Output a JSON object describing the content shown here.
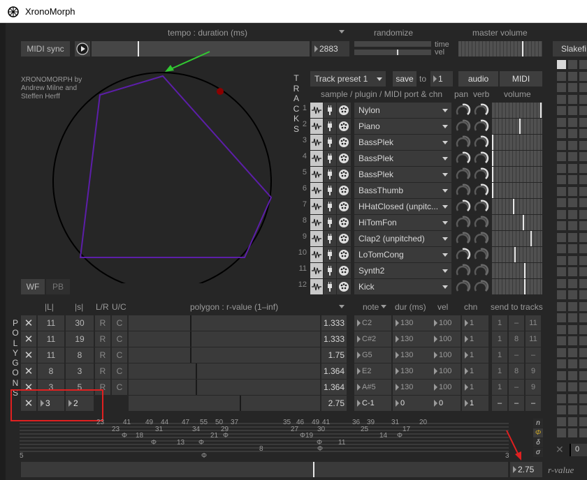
{
  "window": {
    "title": "XronoMorph"
  },
  "transport": {
    "tempo_label": "tempo : duration (ms)",
    "midi_sync": "MIDI sync",
    "tempo_value": "2883",
    "tempo_fraction": 0.21
  },
  "randomize": {
    "label": "randomize",
    "time_label": "time",
    "vel_label": "vel",
    "time_fraction": 0.0,
    "vel_fraction": 0.55
  },
  "master_volume": {
    "label": "master volume",
    "level_fraction": 0.77
  },
  "right_panel": {
    "title": "Slakefi"
  },
  "credits": {
    "line1": "XRONOMORPH by",
    "line2": "Andrew Milne and",
    "line3": "Steffen Herff"
  },
  "tracks": {
    "vertical_label": [
      "T",
      "R",
      "A",
      "C",
      "K",
      "S"
    ],
    "preset": "Track preset 1",
    "save": "save",
    "to": "to",
    "to_value": "1",
    "audio": "audio",
    "midi": "MIDI",
    "col_sample": "sample / plugin / MIDI port & chn",
    "col_pan": "pan",
    "col_verb": "verb",
    "col_volume": "volume",
    "rows": [
      {
        "num": "1",
        "name": "Nylon",
        "vol": 0.99
      },
      {
        "num": "2",
        "name": "Piano",
        "vol": 0.55
      },
      {
        "num": "3",
        "name": "BassPlek",
        "vol": 0.0
      },
      {
        "num": "4",
        "name": "BassPlek",
        "vol": 0.0
      },
      {
        "num": "5",
        "name": "BassPlek",
        "vol": 0.0
      },
      {
        "num": "6",
        "name": "BassThumb",
        "vol": 0.0
      },
      {
        "num": "7",
        "name": "HHatClosed (unpitc...",
        "vol": 0.43
      },
      {
        "num": "8",
        "name": "HiTomFon",
        "vol": 0.63
      },
      {
        "num": "9",
        "name": "Clap2 (unpitched)",
        "vol": 0.78
      },
      {
        "num": "10",
        "name": "LoTomCong",
        "vol": 0.46
      },
      {
        "num": "11",
        "name": "Synth2",
        "vol": 0.65
      },
      {
        "num": "12",
        "name": "Kick",
        "vol": 0.65
      }
    ]
  },
  "view_buttons": {
    "wf": "WF",
    "pb": "PB"
  },
  "polygons": {
    "vertical_label": [
      "P",
      "O",
      "L",
      "Y",
      "G",
      "O",
      "N",
      "S"
    ],
    "col_L": "|L|",
    "col_s": "|s|",
    "col_lr": "L/R",
    "col_uc": "U/C",
    "col_poly": "polygon : r-value (1–inf)",
    "col_note": "note",
    "col_dur": "dur (ms)",
    "col_vel": "vel",
    "col_chn": "chn",
    "col_send": "send to tracks",
    "rows": [
      {
        "x": "✕",
        "L": "11",
        "s": "30",
        "lr": "R",
        "uc": "C",
        "r": "1.333",
        "rf": 0.32,
        "note": "C2",
        "dur": "130",
        "vel": "100",
        "chn": "1",
        "s1": "1",
        "s2": "–",
        "s3": "11"
      },
      {
        "x": "✕",
        "L": "11",
        "s": "19",
        "lr": "R",
        "uc": "C",
        "r": "1.333",
        "rf": 0.32,
        "note": "C#2",
        "dur": "130",
        "vel": "100",
        "chn": "1",
        "s1": "1",
        "s2": "8",
        "s3": "11"
      },
      {
        "x": "✕",
        "L": "11",
        "s": "8",
        "lr": "R",
        "uc": "C",
        "r": "1.75",
        "rf": 0.32,
        "note": "G5",
        "dur": "130",
        "vel": "100",
        "chn": "1",
        "s1": "1",
        "s2": "–",
        "s3": "–"
      },
      {
        "x": "✕",
        "L": "8",
        "s": "3",
        "lr": "R",
        "uc": "C",
        "r": "1.364",
        "rf": 0.35,
        "note": "E2",
        "dur": "130",
        "vel": "100",
        "chn": "1",
        "s1": "1",
        "s2": "8",
        "s3": "9"
      },
      {
        "x": "✕",
        "L": "3",
        "s": "5",
        "lr": "R",
        "uc": "C",
        "r": "1.364",
        "rf": 0.35,
        "note": "A#5",
        "dur": "130",
        "vel": "100",
        "chn": "1",
        "s1": "1",
        "s2": "–",
        "s3": "9"
      },
      {
        "x": "✕",
        "L": "3",
        "s": "2",
        "lr": "",
        "uc": "",
        "r": "2.75",
        "rf": 0.58,
        "note": "C-1",
        "dur": "0",
        "vel": "0",
        "chn": "1",
        "s1": "–",
        "s2": "–",
        "s3": "–"
      }
    ]
  },
  "pattern_labels": {
    "row1": [
      "23",
      "41",
      "49",
      "44",
      "47",
      "55",
      "50",
      "37",
      "35",
      "46",
      "49",
      "41",
      "36",
      "39",
      "31",
      "20"
    ],
    "row2": [
      "23",
      "31",
      "34",
      "29",
      "27",
      "30",
      "25",
      "17"
    ],
    "row3": [
      "Φ",
      "18",
      "21",
      "Φ",
      "Φ",
      "19",
      "14",
      "Φ"
    ],
    "row4": [
      "Φ",
      "13",
      "Φ",
      "11",
      "Φ"
    ],
    "row5": [
      "8",
      "Φ"
    ],
    "row6": [
      "5",
      "Φ",
      "3"
    ]
  },
  "side_buttons": [
    "n",
    "Φ",
    "δ",
    "σ"
  ],
  "rvalue": {
    "value": "2.75",
    "label": "r-value",
    "fraction": 0.6
  },
  "right_num": "0",
  "colors": {
    "polygon": "#5c1ea8",
    "dot": "#8b0000",
    "highlight": "#e02020",
    "arrow_green": "#32c832",
    "arrow_red": "#e02020"
  }
}
